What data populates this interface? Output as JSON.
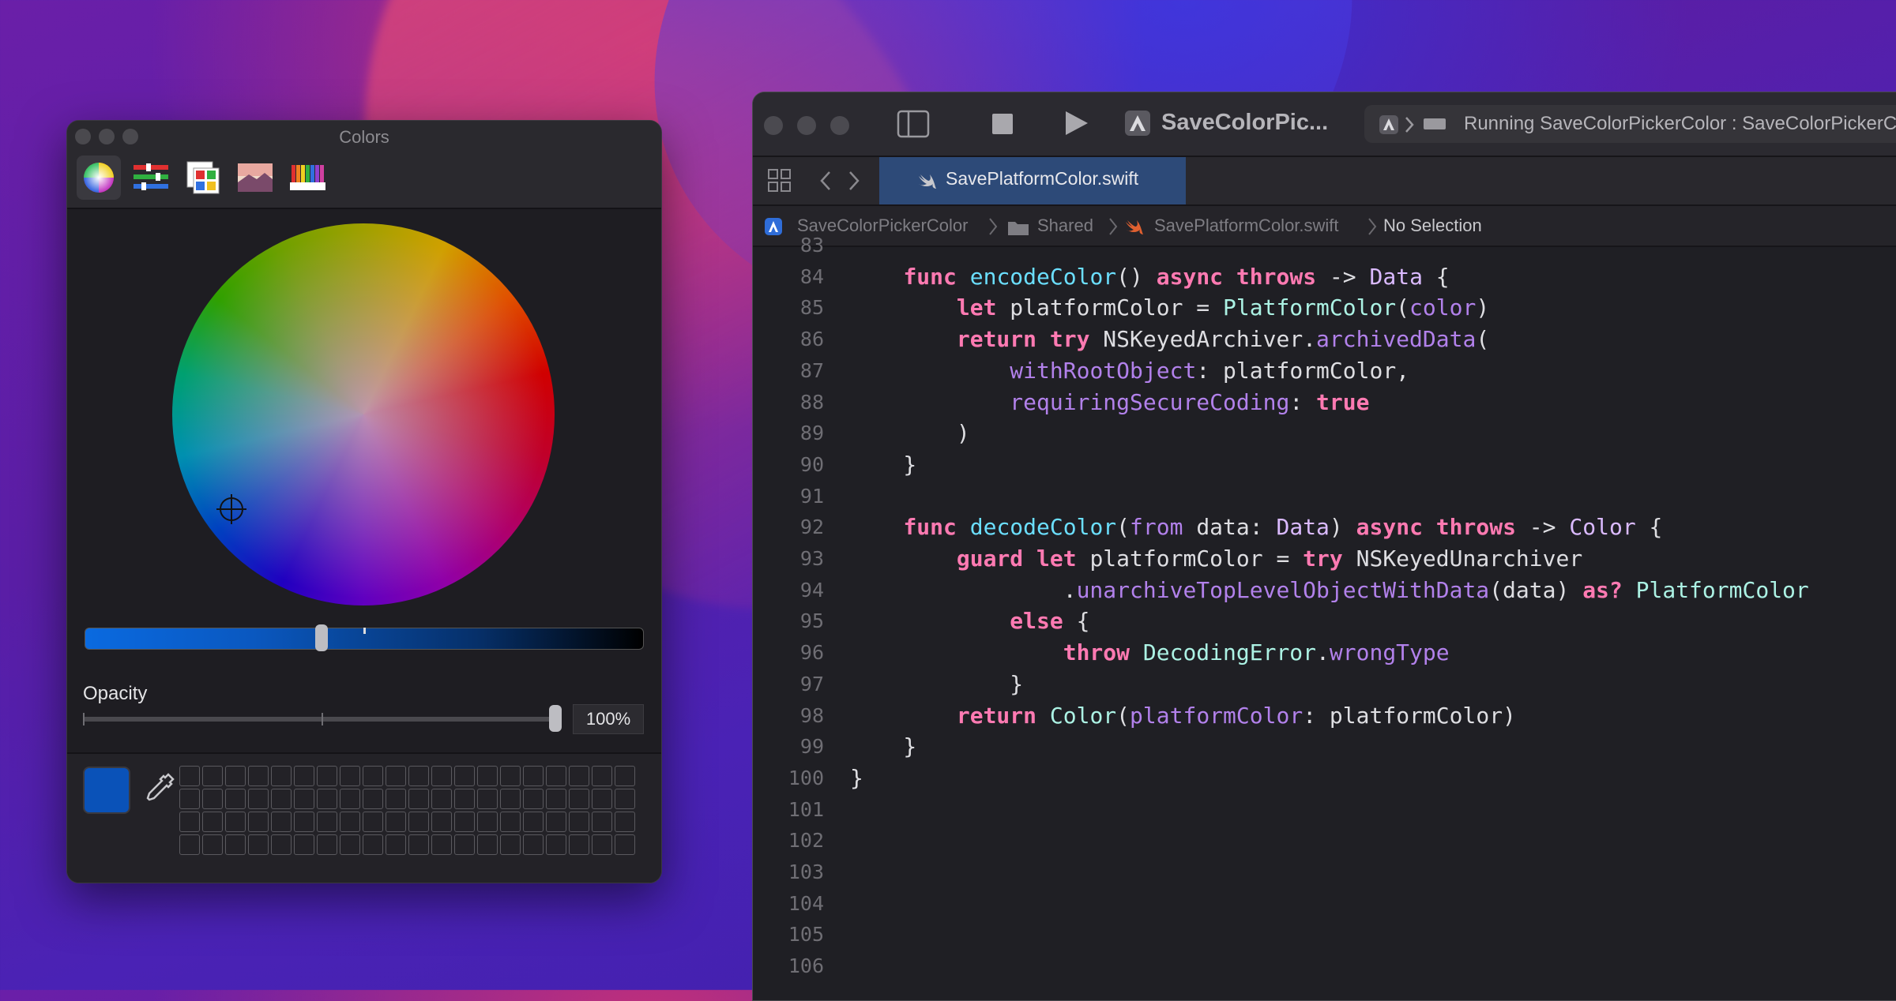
{
  "colors_panel": {
    "title": "Colors",
    "modes": [
      "color-wheel-icon",
      "sliders-icon",
      "palettes-icon",
      "image-palettes-icon",
      "pencils-icon"
    ],
    "opacity_label": "Opacity",
    "opacity_value": "100%",
    "selected_color": "#0a52b8",
    "brightness_level_percent": 42,
    "opacity_level_percent": 100,
    "swatch_columns": 20,
    "swatch_rows": 4
  },
  "xcode": {
    "scheme_title": "SaveColorPic...",
    "status": "Running SaveColorPickerColor : SaveColorPickerCo",
    "tab_label": "SavePlatformColor.swift",
    "jumpbar": {
      "project": "SaveColorPickerColor",
      "group": "Shared",
      "file": "SavePlatformColor.swift",
      "selection": "No Selection"
    },
    "code_lines": [
      {
        "n": "83",
        "t": ""
      },
      {
        "n": "84",
        "t": "<span class=\"kw\">func</span> <span class=\"fn\">encodeColor</span>() <span class=\"kw\">async</span> <span class=\"kw\">throws</span> -> <span class=\"ty\">Data</span> {"
      },
      {
        "n": "85",
        "t": "    <span class=\"kw\">let</span> platformColor = <span class=\"typ\">PlatformColor</span>(<span class=\"pm\">color</span>)"
      },
      {
        "n": "86",
        "t": "    <span class=\"kw\">return</span> <span class=\"kw\">try</span> NSKeyedArchiver.<span class=\"pm\">archivedData</span>("
      },
      {
        "n": "87",
        "t": "        <span class=\"pm\">withRootObject</span>: platformColor,"
      },
      {
        "n": "88",
        "t": "        <span class=\"pm\">requiringSecureCoding</span>: <span class=\"kw\">true</span>"
      },
      {
        "n": "89",
        "t": "    )"
      },
      {
        "n": "90",
        "t": "}"
      },
      {
        "n": "91",
        "t": ""
      },
      {
        "n": "92",
        "t": "<span class=\"kw\">func</span> <span class=\"fn\">decodeColor</span>(<span class=\"pm\">from</span> data: <span class=\"ty\">Data</span>) <span class=\"kw\">async</span> <span class=\"kw\">throws</span> -> <span class=\"ty\">Color</span> {"
      },
      {
        "n": "93",
        "t": "    <span class=\"kw\">guard</span> <span class=\"kw\">let</span> platformColor = <span class=\"kw\">try</span> NSKeyedUnarchiver"
      },
      {
        "n": "94",
        "t": "            .<span class=\"pm\">unarchiveTopLevelObjectWithData</span>(data) <span class=\"kw\">as?</span> <span class=\"typ\">PlatformColor</span>"
      },
      {
        "n": "95",
        "t": "        <span class=\"kw\">else</span> {"
      },
      {
        "n": "96",
        "t": "            <span class=\"kw\">throw</span> <span class=\"typ\">DecodingError</span>.<span class=\"pm\">wrongType</span>"
      },
      {
        "n": "97",
        "t": "        }"
      },
      {
        "n": "98",
        "t": "    <span class=\"kw\">return</span> <span class=\"typ\">Color</span>(<span class=\"pm\">platformColor</span>: platformColor)"
      },
      {
        "n": "99",
        "t": "}"
      },
      {
        "n": "100",
        "t": "}"
      },
      {
        "n": "101",
        "t": ""
      },
      {
        "n": "102",
        "t": ""
      },
      {
        "n": "103",
        "t": ""
      },
      {
        "n": "104",
        "t": ""
      },
      {
        "n": "105",
        "t": ""
      },
      {
        "n": "106",
        "t": ""
      }
    ]
  }
}
